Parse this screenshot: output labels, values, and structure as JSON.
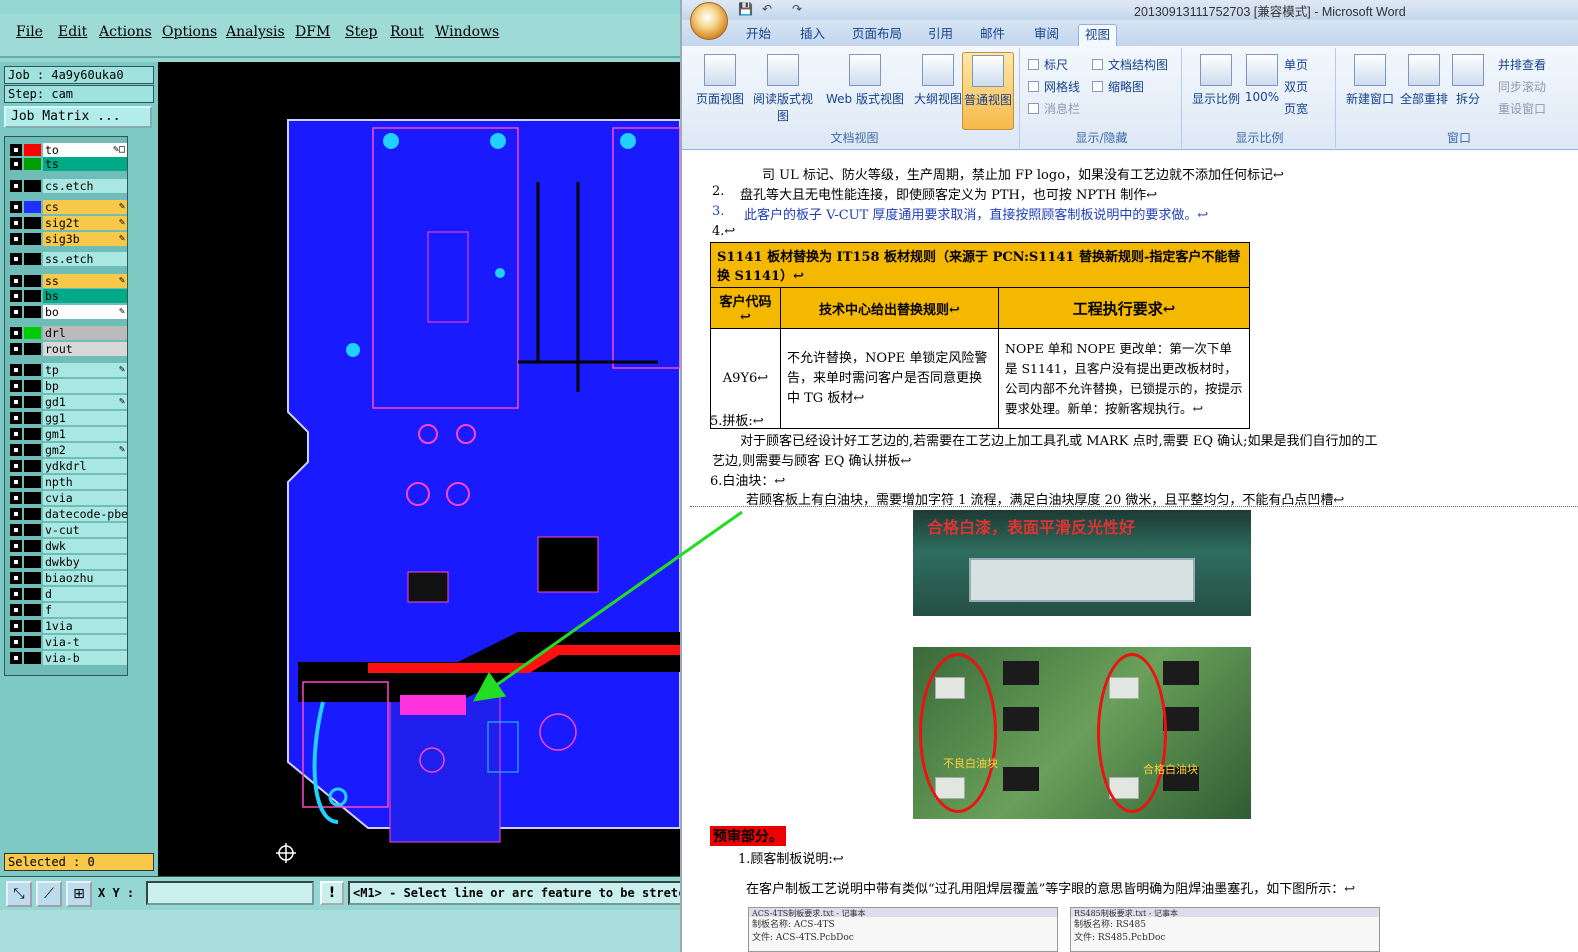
{
  "cam": {
    "menu": [
      "File",
      "Edit",
      "Actions",
      "Options",
      "Analysis",
      "DFM",
      "Step",
      "Rout",
      "Windows"
    ],
    "job": "Job : 4a9y60uka0",
    "step": "Step: cam",
    "job_matrix_button": "Job Matrix ...",
    "layers": [
      {
        "name": "to",
        "color": "#ff0000",
        "bg": "#ffffff",
        "edit": "✎□"
      },
      {
        "name": "ts",
        "color": "#00a000",
        "bg": "#00aa88",
        "edit": ""
      },
      {
        "name": "cs.etch",
        "color": "#000000",
        "bg": "#a9e7e3",
        "edit": ""
      },
      {
        "name": "cs",
        "color": "#2030ff",
        "bg": "#f7c84a",
        "edit": "✎"
      },
      {
        "name": "sig2t",
        "color": "#000000",
        "bg": "#f7c84a",
        "edit": "✎"
      },
      {
        "name": "sig3b",
        "color": "#000000",
        "bg": "#f7c84a",
        "edit": "✎"
      },
      {
        "name": "ss.etch",
        "color": "#000000",
        "bg": "#a9e7e3",
        "edit": ""
      },
      {
        "name": "ss",
        "color": "#000000",
        "bg": "#f7c84a",
        "edit": "✎"
      },
      {
        "name": "bs",
        "color": "#000000",
        "bg": "#00aa88",
        "edit": ""
      },
      {
        "name": "bo",
        "color": "#000000",
        "bg": "#ffffff",
        "edit": "✎"
      },
      {
        "name": "drl",
        "color": "#00cc00",
        "bg": "#bbbbbb",
        "edit": ""
      },
      {
        "name": "rout",
        "color": "#000000",
        "bg": "#d8d8d8",
        "edit": ""
      },
      {
        "name": "tp",
        "color": "#000000",
        "bg": "#a9e7e3",
        "edit": "✎"
      },
      {
        "name": "bp",
        "color": "#000000",
        "bg": "#a9e7e3",
        "edit": ""
      },
      {
        "name": "gd1",
        "color": "#000000",
        "bg": "#a9e7e3",
        "edit": "✎"
      },
      {
        "name": "gg1",
        "color": "#000000",
        "bg": "#a9e7e3",
        "edit": ""
      },
      {
        "name": "gm1",
        "color": "#000000",
        "bg": "#a9e7e3",
        "edit": ""
      },
      {
        "name": "gm2",
        "color": "#000000",
        "bg": "#a9e7e3",
        "edit": "✎"
      },
      {
        "name": "ydkdrl",
        "color": "#000000",
        "bg": "#a9e7e3",
        "edit": ""
      },
      {
        "name": "npth",
        "color": "#000000",
        "bg": "#a9e7e3",
        "edit": ""
      },
      {
        "name": "cvia",
        "color": "#000000",
        "bg": "#a9e7e3",
        "edit": ""
      },
      {
        "name": "datecode-pbe",
        "color": "#000000",
        "bg": "#a9e7e3",
        "edit": ""
      },
      {
        "name": "v-cut",
        "color": "#000000",
        "bg": "#a9e7e3",
        "edit": ""
      },
      {
        "name": "dwk",
        "color": "#000000",
        "bg": "#a9e7e3",
        "edit": ""
      },
      {
        "name": "dwkby",
        "color": "#000000",
        "bg": "#a9e7e3",
        "edit": ""
      },
      {
        "name": "biaozhu",
        "color": "#000000",
        "bg": "#a9e7e3",
        "edit": ""
      },
      {
        "name": "d",
        "color": "#000000",
        "bg": "#a9e7e3",
        "edit": ""
      },
      {
        "name": "f",
        "color": "#000000",
        "bg": "#a9e7e3",
        "edit": ""
      },
      {
        "name": "1via",
        "color": "#000000",
        "bg": "#a9e7e3",
        "edit": ""
      },
      {
        "name": "via-t",
        "color": "#000000",
        "bg": "#a9e7e3",
        "edit": ""
      },
      {
        "name": "via-b",
        "color": "#000000",
        "bg": "#a9e7e3",
        "edit": ""
      }
    ],
    "selected": "Selected : 0",
    "xy_label": "X Y :",
    "xy_value": "",
    "bang": "!",
    "prompt": "<M1> - Select line or arc feature to be stretched"
  },
  "word": {
    "title": "20130913111752703 [兼容模式] - Microsoft Word",
    "tabs": [
      "开始",
      "插入",
      "页面布局",
      "引用",
      "邮件",
      "审阅",
      "视图"
    ],
    "active_tab": "视图",
    "groups": {
      "doc_views": {
        "label": "文档视图",
        "buttons": [
          "页面视图",
          "阅读版式视图",
          "Web 版式视图",
          "大纲视图",
          "普通视图"
        ]
      },
      "show_hide": {
        "label": "显示/隐藏",
        "items": [
          "标尺",
          "网格线",
          "消息栏",
          "文档结构图",
          "缩略图"
        ]
      },
      "zoom": {
        "label": "显示比例",
        "buttons": [
          "显示比例",
          "100%"
        ],
        "items": [
          "单页",
          "双页",
          "页宽"
        ]
      },
      "window": {
        "label": "窗口",
        "buttons": [
          "新建窗口",
          "全部重排",
          "拆分"
        ],
        "items": [
          "并排查看",
          "同步滚动",
          "重设窗口"
        ]
      }
    },
    "doc": {
      "line1": "司 UL 标记、防火等级，生产周期，禁止加 FP logo，如果没有工艺边就不添加任何标记↩",
      "item2_num": "2.",
      "item2": "盘孔等大且无电性能连接，即使顾客定义为 PTH，也可按 NPTH 制作↩",
      "item3_num": "3.",
      "item3": "此客户的板子 V-CUT 厚度通用要求取消，直接按照顾客制板说明中的要求做。↩",
      "item4": "4.↩",
      "table_title": "S1141 板材替换为 IT158 板材规则（来源于 PCN:S1141 替换新规则-指定客户不能替换 S1141）↩",
      "th1": "客户代码↩",
      "th2": "技术中心给出替换规则↩",
      "th3": "工程执行要求↩",
      "td1": "A9Y6↩",
      "td2": "不允许替换，NOPE 单锁定风险警告，来单时需问客户是否同意更换中 TG 板材↩",
      "td3": "NOPE 单和 NOPE 更改单：第一次下单是 S1141，且客户没有提出更改板材时，公司内部不允许替换，已锁提示的，按提示要求处理。新单：按新客规执行。↩",
      "item5": "5.拼板:↩",
      "item5_body1": "对于顾客已经设计好工艺边的,若需要在工艺边上加工具孔或 MARK 点时,需要 EQ 确认;如果是我们自行加的工",
      "item5_body2": "艺边,则需要与顾客 EQ 确认拼板↩",
      "item6": "6.白油块：↩",
      "item6_body": "若顾客板上有白油块，需要增加字符 1 流程，满足白油块厚度 20 微米，且平整均匀，不能有凸点凹槽↩",
      "img1_caption": "合格白漆，表面平滑反光性好",
      "img2_bad": "不良白油块",
      "img2_good": "合格白油块",
      "review_heading": "预审部分。",
      "review_item": "1.顾客制板说明:↩",
      "review_body": "在客户制板工艺说明中带有类似“过孔用阻焊层覆盖”等字眼的意思皆明确为阻焊油墨塞孔，如下图所示：↩",
      "thumb1_title": "ACS-4TS制板要求.txt - 记事本",
      "thumb1_line1": "制板名称: ACS-4TS",
      "thumb1_line2": "文件: ACS-4TS.PcbDoc",
      "thumb2_title": "RS485制板要求.txt - 记事本",
      "thumb2_line1": "制板名称: RS485",
      "thumb2_line2": "文件: RS485.PcbDoc"
    }
  },
  "colors": {
    "board": "#1a1aff",
    "cam_bg": "#94d7d3",
    "highlight": "#f5b800"
  }
}
